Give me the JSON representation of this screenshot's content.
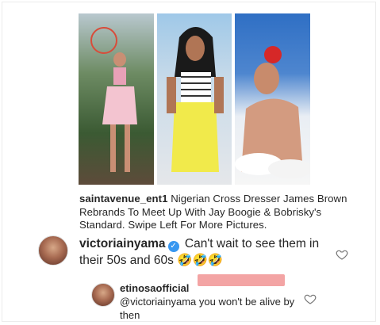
{
  "post": {
    "caption_user": "saintavenue_ent1",
    "caption_text": "Nigerian Cross Dresser James Brown Rebrands To Meet Up With Jay Boogie & Bobrisky's Standard. Swipe Left For More Pictures."
  },
  "comments": [
    {
      "username": "victoriainyama",
      "text": "Can't wait to see them in their 50s and 60s",
      "emoji": "🤣🤣🤣",
      "verified": true
    },
    {
      "username": "etinosaofficial",
      "mention": "@victoriainyama",
      "text": "you won't be alive by then"
    }
  ],
  "icons": [
    "photo-1",
    "photo-2",
    "photo-3",
    "avatar",
    "verified-badge-icon",
    "heart-icon"
  ],
  "colors": {
    "verified": "#3897f0",
    "redaction": "#e95a5a"
  }
}
